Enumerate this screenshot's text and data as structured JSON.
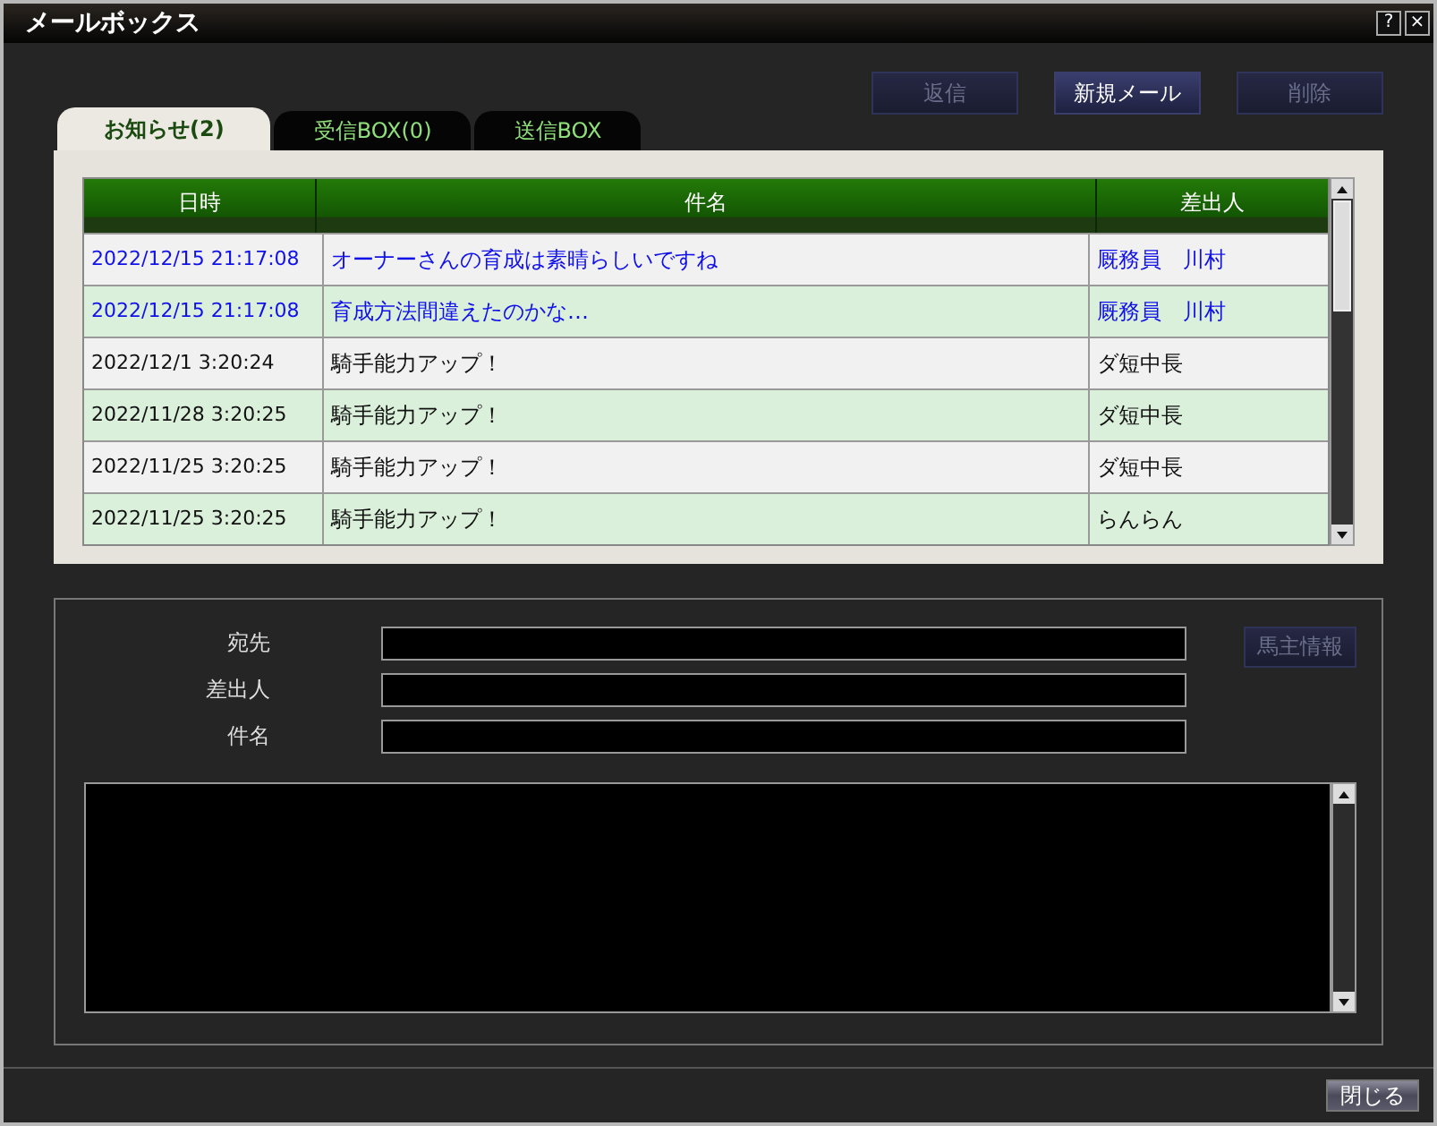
{
  "window": {
    "title": "メールボックス",
    "help": "?",
    "close": "×"
  },
  "actions": [
    {
      "label": "返信",
      "disabled": true
    },
    {
      "label": "新規メール",
      "disabled": false
    },
    {
      "label": "削除",
      "disabled": true
    }
  ],
  "tabs": [
    {
      "label": "お知らせ(2)",
      "selected": true
    },
    {
      "label": "受信BOX(0)",
      "selected": false
    },
    {
      "label": "送信BOX",
      "selected": false
    }
  ],
  "table": {
    "columns": [
      "日時",
      "件名",
      "差出人"
    ],
    "rows": [
      {
        "cells": [
          "2022/12/15 21:17:08",
          "オーナーさんの育成は素晴らしいですね",
          "厩務員　川村"
        ],
        "unread": true
      },
      {
        "cells": [
          "2022/12/15 21:17:08",
          "育成方法間違えたのかな…",
          "厩務員　川村"
        ],
        "unread": true
      },
      {
        "cells": [
          "2022/12/1 3:20:24",
          "騎手能力アップ！",
          "ダ短中長"
        ],
        "unread": false
      },
      {
        "cells": [
          "2022/11/28 3:20:25",
          "騎手能力アップ！",
          "ダ短中長"
        ],
        "unread": false
      },
      {
        "cells": [
          "2022/11/25 3:20:25",
          "騎手能力アップ！",
          "ダ短中長"
        ],
        "unread": false
      },
      {
        "cells": [
          "2022/11/25 3:20:25",
          "騎手能力アップ！",
          "らんらん"
        ],
        "unread": false
      }
    ]
  },
  "fields": [
    {
      "label": "宛先"
    },
    {
      "label": "差出人"
    },
    {
      "label": "件名"
    }
  ],
  "owner_button": {
    "label": "馬主情報",
    "disabled": true
  },
  "close_button": {
    "label": "閉じる"
  }
}
